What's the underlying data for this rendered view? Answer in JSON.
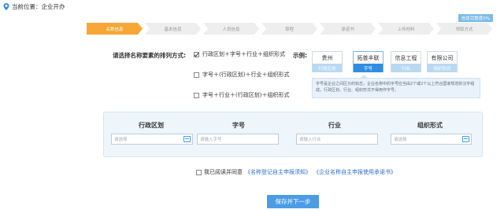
{
  "header": {
    "location_label": "当前位置：企业开办",
    "location_icon": "location-pin-icon"
  },
  "progress": {
    "label": "信息完整度0%"
  },
  "steps": [
    {
      "label": "名称信息",
      "active": true
    },
    {
      "label": "基本信息",
      "active": false
    },
    {
      "label": "人员信息",
      "active": false
    },
    {
      "label": "章程",
      "active": false
    },
    {
      "label": "承诺书",
      "active": false
    },
    {
      "label": "上传材料",
      "active": false
    },
    {
      "label": "领取方式",
      "active": false
    }
  ],
  "ranking": {
    "label": "请选择名称要素的排列方式:",
    "options": [
      {
        "label": "行政区划＋字号＋行业＋组织形式",
        "checked": true
      },
      {
        "label": "字号＋(行政区划)＋行业＋组织形式",
        "checked": false
      },
      {
        "label": "字号＋行业＋(行政区划)＋组织形式",
        "checked": false
      }
    ]
  },
  "example": {
    "label": "示例:",
    "cards": [
      {
        "top": "贵州",
        "bottom": "行政区划"
      },
      {
        "top": "拓普丰联",
        "bottom": "字号"
      },
      {
        "top": "信息工程",
        "bottom": "行业"
      },
      {
        "top": "有限公司",
        "bottom": "组织形式"
      }
    ],
    "tip": "字号是企业之间区分的标志，企业名称中的字号应当由2个或2个以上符合国家规范的汉字组成，行政区划、行业、组织形式不得用作字号。"
  },
  "fields": [
    {
      "header": "行政区划",
      "placeholder": "请选择"
    },
    {
      "header": "字号",
      "placeholder": "请输入字号"
    },
    {
      "header": "行业",
      "placeholder": "请输入行业"
    },
    {
      "header": "组织形式",
      "placeholder": "请选择"
    }
  ],
  "agreement": {
    "prefix": "我已阅读并同意",
    "link1": "《名称登记自主申报须知》",
    "link2": "《企业名称自主申报使用承诺书》"
  },
  "actions": {
    "save_label": "保存并下一步"
  },
  "colors": {
    "accent": "#f6a735",
    "primary": "#4b9ce5",
    "link": "#2e70c6"
  }
}
